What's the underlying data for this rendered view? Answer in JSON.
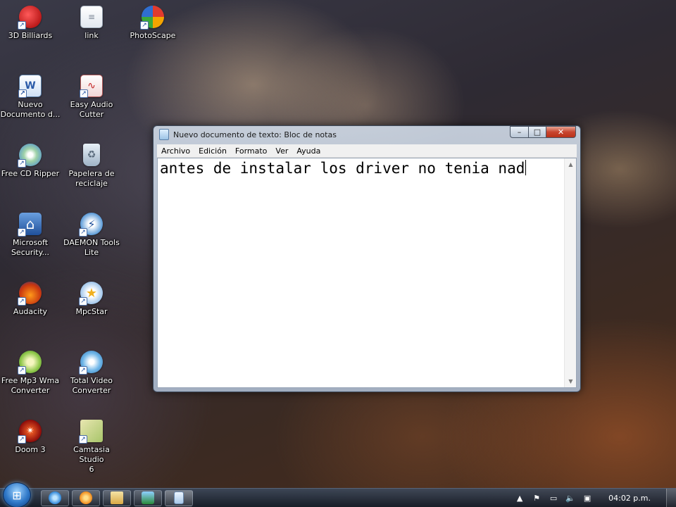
{
  "desktop": {
    "icons": [
      {
        "label": "3D Billiards",
        "icon": "billiard-ball-icon"
      },
      {
        "label": "link",
        "icon": "text-file-icon"
      },
      {
        "label": "PhotoScape",
        "icon": "photoscape-icon"
      },
      {
        "label": "Nuevo\nDocumento d...",
        "icon": "word-document-icon"
      },
      {
        "label": "Easy Audio\nCutter",
        "icon": "audio-cutter-icon"
      },
      {
        "label": "Free CD Ripper",
        "icon": "cd-ripper-icon"
      },
      {
        "label": "Papelera de\nreciclaje",
        "icon": "recycle-bin-icon"
      },
      {
        "label": "Microsoft\nSecurity...",
        "icon": "security-essentials-icon"
      },
      {
        "label": "DAEMON Tools\nLite",
        "icon": "daemon-tools-icon"
      },
      {
        "label": "Audacity",
        "icon": "audacity-icon"
      },
      {
        "label": "MpcStar",
        "icon": "mpcstar-icon"
      },
      {
        "label": "Free Mp3 Wma\nConverter",
        "icon": "mp3-converter-icon"
      },
      {
        "label": "Total Video\nConverter",
        "icon": "video-converter-icon"
      },
      {
        "label": "Doom 3",
        "icon": "doom-icon"
      },
      {
        "label": "Camtasia Studio\n6",
        "icon": "camtasia-icon"
      }
    ]
  },
  "notepad": {
    "title": "Nuevo documento de texto: Bloc de notas",
    "menu": [
      "Archivo",
      "Edición",
      "Formato",
      "Ver",
      "Ayuda"
    ],
    "content": "antes de instalar los driver no tenia nad",
    "buttons": {
      "minimize": "–",
      "maximize": "□",
      "close": "✕"
    }
  },
  "taskbar": {
    "start_icon": "windows-start-icon",
    "pinned": [
      "internet-explorer-icon",
      "media-player-icon",
      "file-explorer-icon",
      "photo-app-icon",
      "notepad-icon"
    ],
    "clock": "04:02 p.m."
  },
  "colors": {
    "titlebar_close": "#c8452f",
    "taskbar": "#1c2636",
    "editor_bg": "#ffffff"
  }
}
